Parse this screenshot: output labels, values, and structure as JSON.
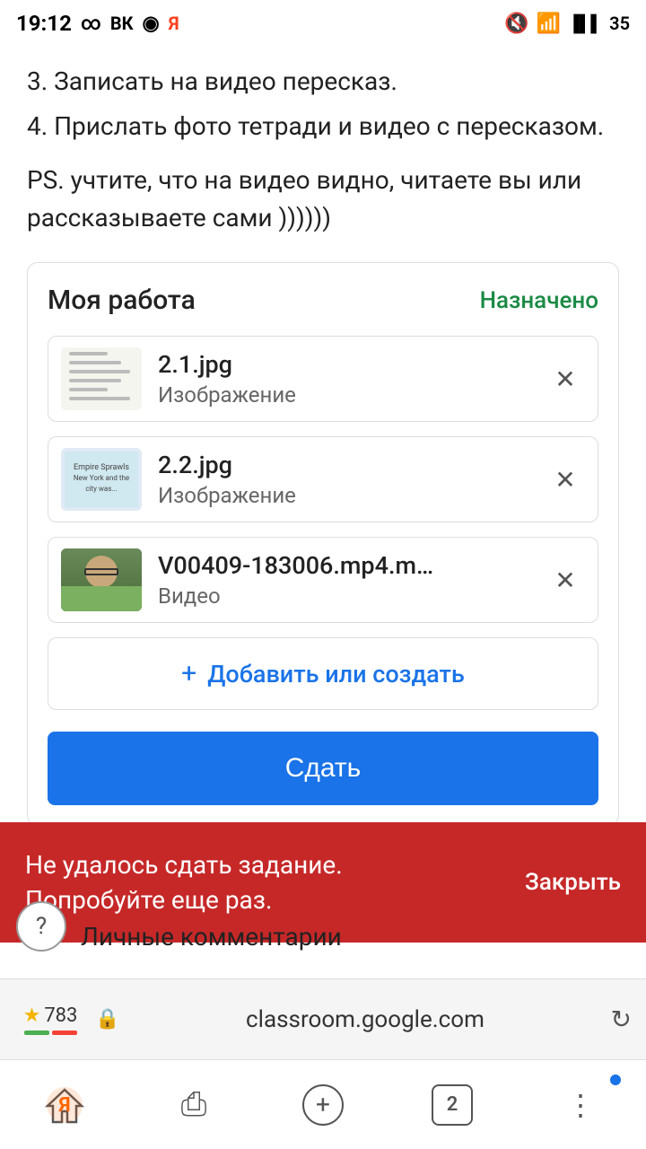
{
  "statusBar": {
    "time": "19:12",
    "battery": "35"
  },
  "content": {
    "instruction3": "3. Записать на видео пересказ.",
    "instruction4": "4. Прислать фото тетради и видео с пересказом.",
    "ps": "PS. учтите, что на видео видно, читаете вы или\nрассказываете сами ))))))"
  },
  "myWork": {
    "title": "Моя работа",
    "status": "Назначено",
    "files": [
      {
        "name": "2.1.jpg",
        "type": "Изображение",
        "thumbType": "handwritten"
      },
      {
        "name": "2.2.jpg",
        "type": "Изображение",
        "thumbType": "map"
      },
      {
        "name": "V00409-183006.mp4.m…",
        "type": "Видео",
        "thumbType": "video"
      }
    ],
    "addButton": "+ Добавить или создать",
    "addIcon": "+",
    "addLabel": "Добавить или создать",
    "submitButton": "Сдать"
  },
  "errorToast": {
    "message": "Не удалось сдать задание.\nПопробуйте еще раз.",
    "closeLabel": "Закрыть"
  },
  "helpButton": "?",
  "personalComments": "Личные комментарии",
  "browserBar": {
    "rating": "783",
    "lockIcon": "🔒",
    "url": "classroom.google.com"
  },
  "navBar": {
    "tabCount": "2"
  }
}
